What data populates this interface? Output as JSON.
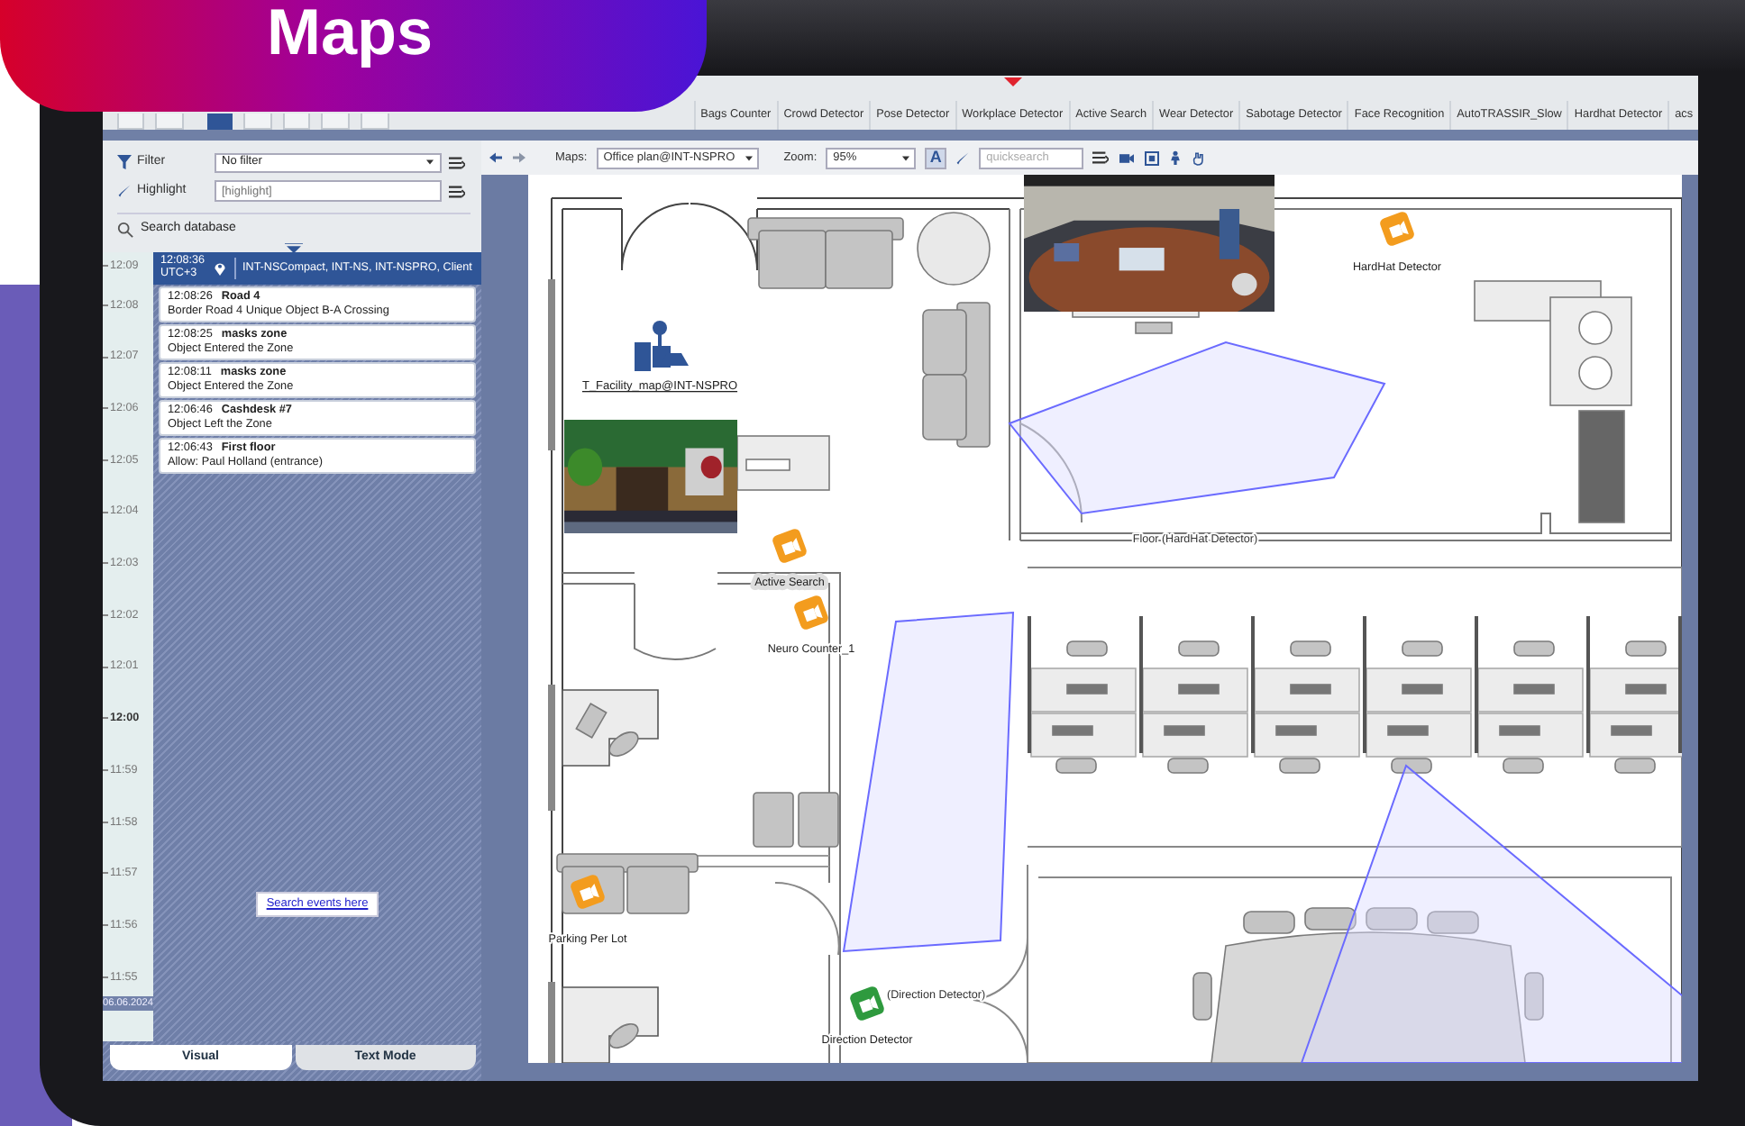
{
  "promo": {
    "title": "Maps"
  },
  "toolbar_buttons": [
    {
      "selected": false
    },
    {
      "selected": false
    },
    {
      "selected": true
    },
    {
      "selected": false
    },
    {
      "selected": false
    },
    {
      "selected": false
    },
    {
      "selected": false
    }
  ],
  "detector_tabs": [
    {
      "label": "Bags Counter",
      "alert": false
    },
    {
      "label": "Crowd Detector",
      "alert": false
    },
    {
      "label": "Pose Detector",
      "alert": false
    },
    {
      "label": "Workplace Detector",
      "alert": true
    },
    {
      "label": "Active Search",
      "alert": false
    },
    {
      "label": "Wear Detector",
      "alert": false
    },
    {
      "label": "Sabotage Detector",
      "alert": false
    },
    {
      "label": "Face Recognition",
      "alert": false
    },
    {
      "label": "AutoTRASSIR_Slow",
      "alert": false
    },
    {
      "label": "Hardhat Detector",
      "alert": false
    },
    {
      "label": "acs",
      "alert": false
    }
  ],
  "events_panel": {
    "filter": {
      "label": "Filter",
      "value": "No filter"
    },
    "highlight": {
      "label": "Highlight",
      "placeholder": "[highlight]"
    },
    "search_database": "Search database",
    "current": {
      "time": "12:08:36",
      "zone": "UTC+3",
      "servers": "INT-NSCompact, INT-NS, INT-NSPRO, Client"
    },
    "events": [
      {
        "time": "12:08:26",
        "title": "Road 4",
        "text": "Border Road 4 Unique Object B-A Crossing"
      },
      {
        "time": "12:08:25",
        "title": "masks zone",
        "text": "Object Entered the Zone"
      },
      {
        "time": "12:08:11",
        "title": "masks zone",
        "text": "Object Entered the Zone"
      },
      {
        "time": "12:06:46",
        "title": "Cashdesk #7",
        "text": "Object Left the Zone"
      },
      {
        "time": "12:06:43",
        "title": "First floor",
        "text": "Allow: Paul Holland (entrance)"
      }
    ],
    "search_events": "Search events here",
    "timeline": [
      {
        "label": "12:09",
        "major": false
      },
      {
        "label": "12:08",
        "major": false
      },
      {
        "label": "12:07",
        "major": false
      },
      {
        "label": "12:06",
        "major": false
      },
      {
        "label": "12:05",
        "major": false
      },
      {
        "label": "12:04",
        "major": false
      },
      {
        "label": "12:03",
        "major": false
      },
      {
        "label": "12:02",
        "major": false
      },
      {
        "label": "12:01",
        "major": false
      },
      {
        "label": "12:00",
        "major": true
      },
      {
        "label": "11:59",
        "major": false
      },
      {
        "label": "11:58",
        "major": false
      },
      {
        "label": "11:57",
        "major": false
      },
      {
        "label": "11:56",
        "major": false
      },
      {
        "label": "11:55",
        "major": false
      }
    ],
    "date": "06.06.2024",
    "tabs": [
      {
        "label": "Visual",
        "selected": true
      },
      {
        "label": "Text Mode",
        "selected": false
      }
    ]
  },
  "map_toolbar": {
    "maps_label": "Maps:",
    "map": "Office plan@INT-NSPRO",
    "zoom_label": "Zoom:",
    "zoom": "95%",
    "font_button": {
      "label": "A",
      "selected": true
    },
    "quicksearch_placeholder": "quicksearch"
  },
  "map": {
    "facility_link": "T_Facility_map@INT-NSPRO",
    "zone_label": "Floor (HardHat Detector)",
    "markers": [
      {
        "label": "HardHat Detector",
        "color": "#f39c1e",
        "highlighted": false
      },
      {
        "label": "Active Search",
        "color": "#f39c1e",
        "highlighted": true
      },
      {
        "label": "Neuro Counter_1",
        "color": "#f39c1e",
        "highlighted": false
      },
      {
        "label": "Parking Per Lot",
        "color": "#f39c1e",
        "highlighted": false
      },
      {
        "label": "Direction Detector",
        "color": "#2e9a3e",
        "highlighted": false,
        "tag": "(Direction Detector)"
      }
    ]
  }
}
